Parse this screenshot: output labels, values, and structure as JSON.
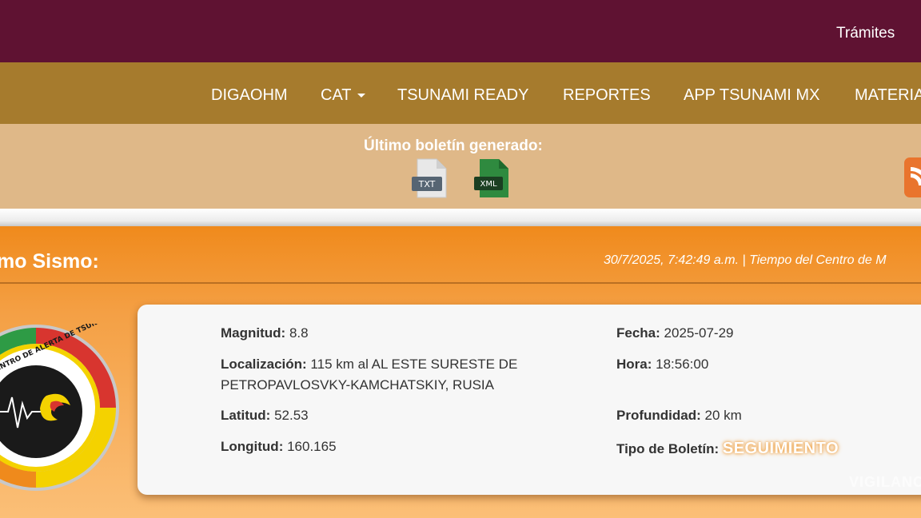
{
  "topbar": {
    "link": "Trámites",
    "bg": "#5f1232"
  },
  "nav": {
    "items": [
      "DIGAOHM",
      "CAT",
      "TSUNAMI READY",
      "REPORTES",
      "APP TSUNAMI MX",
      "MATERIA"
    ],
    "bg": "#a67b2d"
  },
  "bulletin": {
    "title": "Último boletín generado:",
    "files": [
      {
        "label": "TXT",
        "icon": "txt-file-icon"
      },
      {
        "label": "XML",
        "icon": "xml-file-icon"
      }
    ],
    "feed_icon": "rss-icon"
  },
  "quake": {
    "heading": "mo Sismo:",
    "timestamp": "30/7/2025, 7:42:49 a.m. | Tiempo del Centro de M",
    "logo_text": "CENTRO DE ALERTA DE TSUNAMIS",
    "fields": {
      "magnitud": {
        "label": "Magnitud:",
        "value": "8.8"
      },
      "localizacion": {
        "label": "Localización:",
        "value": "115 km al AL ESTE SURESTE DE"
      },
      "localizacion_cont": "PETROPAVLOSVKY-KAMCHATSKIY, RUSIA",
      "latitud": {
        "label": "Latitud:",
        "value": "52.53"
      },
      "longitud": {
        "label": "Longitud:",
        "value": "160.165"
      },
      "fecha": {
        "label": "Fecha:",
        "value": "2025-07-29"
      },
      "hora": {
        "label": "Hora:",
        "value": "18:56:00"
      },
      "profundidad": {
        "label": "Profundidad:",
        "value": "20 km"
      },
      "tipo": {
        "label": "Tipo de Boletín:",
        "value": "SEGUIMIENTO"
      }
    },
    "ghost_text": "VIGILANCIA"
  }
}
